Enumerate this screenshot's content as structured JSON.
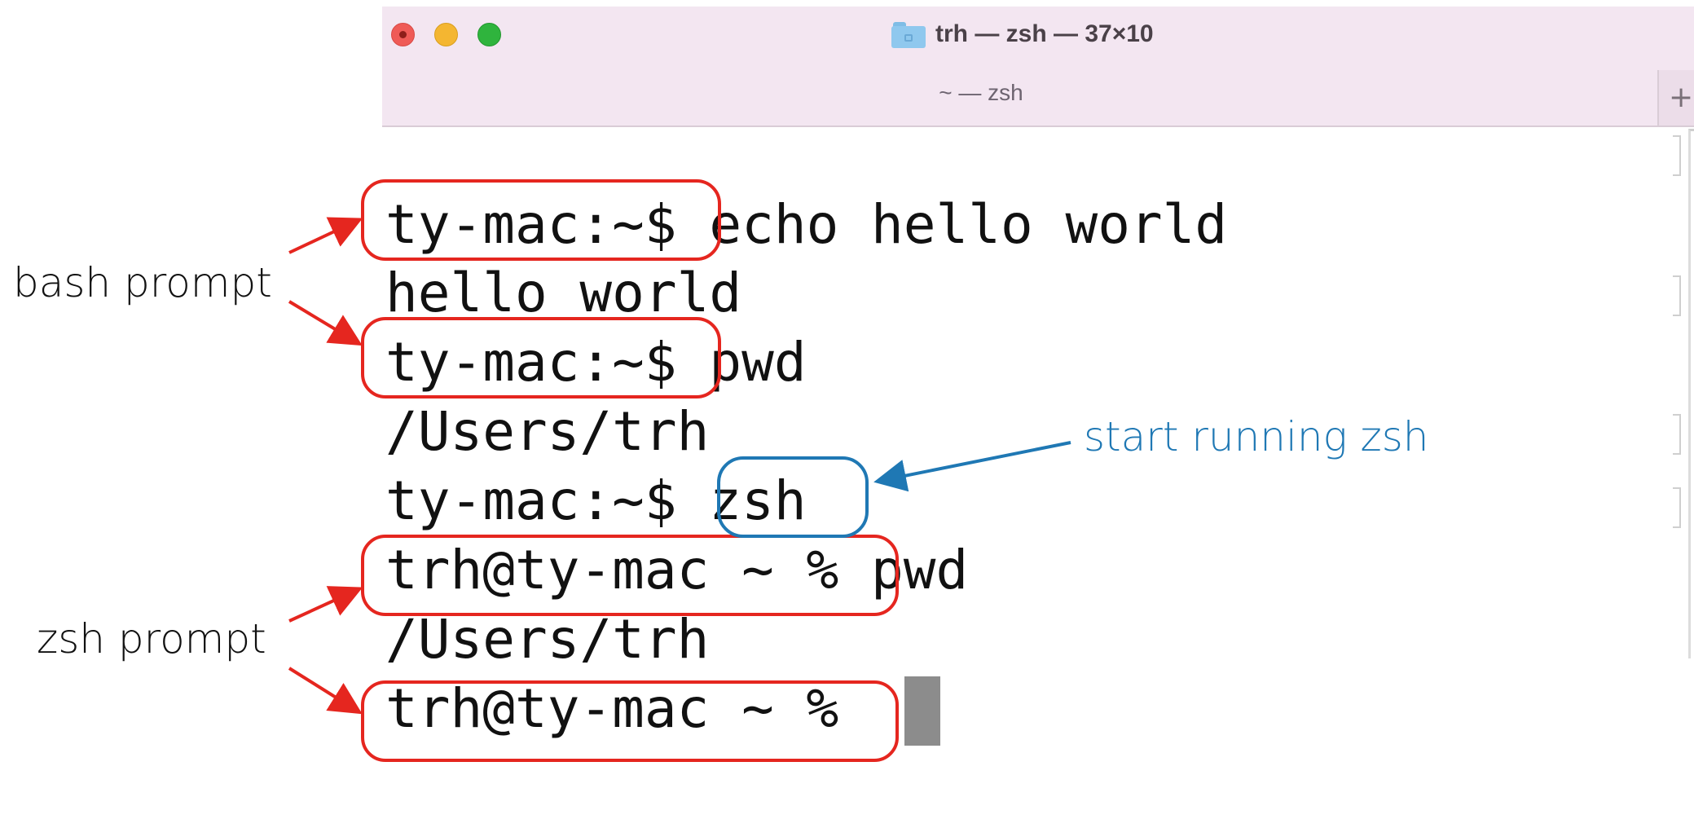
{
  "window": {
    "title": "trh — zsh — 37×10",
    "tab_title": "~ — zsh",
    "new_tab_symbol": "+",
    "colors": {
      "titlebar": "#f3e6f1",
      "close": "#ef5b57",
      "minimize": "#f4b631",
      "maximize": "#2fb43d"
    }
  },
  "terminal": {
    "lines": [
      {
        "prompt": "ty-mac:~$",
        "command": "echo hello world"
      },
      {
        "output": "hello world"
      },
      {
        "prompt": "ty-mac:~$",
        "command": "pwd"
      },
      {
        "output": "/Users/trh"
      },
      {
        "prompt": "ty-mac:~$",
        "command": "zsh"
      },
      {
        "prompt": "trh@ty-mac ~ %",
        "command": "pwd"
      },
      {
        "output": "/Users/trh"
      },
      {
        "prompt": "trh@ty-mac ~ %",
        "command": ""
      }
    ]
  },
  "annotations": {
    "bash_prompt": "bash prompt",
    "zsh_prompt": "zsh prompt",
    "start_zsh": "start running zsh",
    "colors": {
      "prompt_box": "#e5261f",
      "command_box": "#1f78b4"
    }
  }
}
